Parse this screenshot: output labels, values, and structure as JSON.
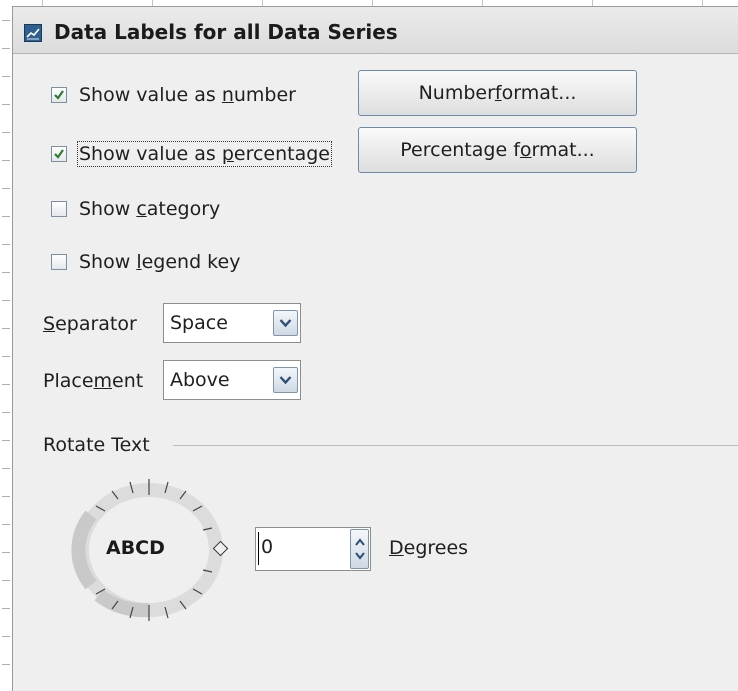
{
  "dialog": {
    "title": "Data Labels for all Data Series",
    "icon": "chart-app-icon"
  },
  "options": {
    "show_number": {
      "pre": "Show value as ",
      "mnemonic": "n",
      "post": "umber",
      "checked": true
    },
    "show_percentage": {
      "pre": "Show value as ",
      "mnemonic": "p",
      "post": "ercentage",
      "checked": true
    },
    "show_category": {
      "pre": "Show ",
      "mnemonic": "c",
      "post": "ategory",
      "checked": false
    },
    "show_legend_key": {
      "pre": "Show ",
      "mnemonic": "l",
      "post": "egend key",
      "checked": false
    }
  },
  "buttons": {
    "number_format": {
      "pre": "Number ",
      "mnemonic": "f",
      "post": "ormat..."
    },
    "percentage_format": {
      "pre": "Percentage f",
      "mnemonic": "o",
      "post": "rmat..."
    }
  },
  "separator": {
    "label_mnemonic": "S",
    "label_rest": "eparator",
    "value": "Space"
  },
  "placement": {
    "label_pre": "Place",
    "label_mnemonic": "m",
    "label_post": "ent",
    "value": "Above"
  },
  "rotate": {
    "group_label": "Rotate Text",
    "dial_text": "ABCD",
    "degrees_value": "0",
    "degrees_mnemonic": "D",
    "degrees_rest": "egrees"
  },
  "colors": {
    "check": "#2e7d32",
    "button_border": "#6d8aa8",
    "dialog_bg": "#efefef"
  }
}
